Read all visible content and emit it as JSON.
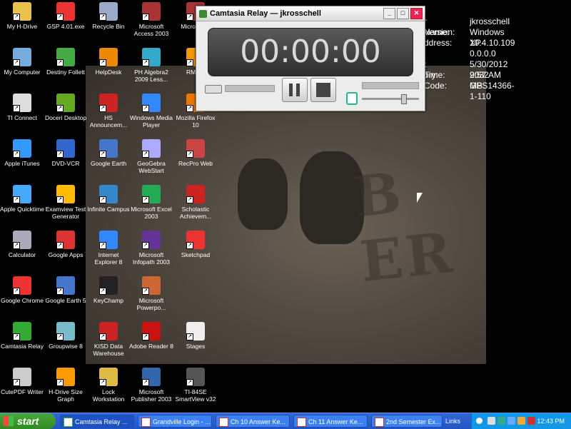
{
  "desktop": {
    "icons": [
      {
        "id": "my-h-drive",
        "label": "My H-Drive",
        "color": "#e8c24a"
      },
      {
        "id": "gsp",
        "label": "GSP 4.01.exe",
        "color": "#e33"
      },
      {
        "id": "recycle-bin",
        "label": "Recycle Bin",
        "color": "#9ac"
      },
      {
        "id": "ms-access",
        "label": "Microsoft Access 2003",
        "color": "#a33"
      },
      {
        "id": "ms-20",
        "label": "Microso 20",
        "color": "#a33"
      },
      {
        "id": "my-computer",
        "label": "My Computer",
        "color": "#7ad"
      },
      {
        "id": "destiny",
        "label": "Destiny Follett",
        "color": "#4a4"
      },
      {
        "id": "helpdesk",
        "label": "HelpDesk",
        "color": "#e80"
      },
      {
        "id": "ph-algebra",
        "label": "PH Algebra2 2009 Less...",
        "color": "#3ac"
      },
      {
        "id": "rm-ea",
        "label": "RM Ea",
        "color": "#e90"
      },
      {
        "id": "ti-connect",
        "label": "TI Connect",
        "color": "#ddd"
      },
      {
        "id": "doceri",
        "label": "Doceri Desktop",
        "color": "#6a2"
      },
      {
        "id": "hs-announce",
        "label": "HS Announcem...",
        "color": "#c22"
      },
      {
        "id": "wmp",
        "label": "Windows Media Player",
        "color": "#38f"
      },
      {
        "id": "firefox",
        "label": "Mozilla Firefox 10",
        "color": "#e70"
      },
      {
        "id": "itunes",
        "label": "Apple iTunes",
        "color": "#39f"
      },
      {
        "id": "dvd-vcr",
        "label": "DVD-VCR",
        "color": "#36c"
      },
      {
        "id": "google-earth",
        "label": "Google Earth",
        "color": "#47c"
      },
      {
        "id": "geogebra",
        "label": "GeoGebra WebStart",
        "color": "#aaf"
      },
      {
        "id": "recpro",
        "label": "RecPro Web",
        "color": "#c44"
      },
      {
        "id": "quicktime",
        "label": "Apple Quicktime",
        "color": "#4af"
      },
      {
        "id": "examview",
        "label": "Examview Test Generator",
        "color": "#fb0"
      },
      {
        "id": "infinite-campus",
        "label": "Infinite Campus",
        "color": "#38c"
      },
      {
        "id": "ms-excel",
        "label": "Microsoft Excel 2003",
        "color": "#2a5"
      },
      {
        "id": "scholastic",
        "label": "Scholastic Achievem...",
        "color": "#c22"
      },
      {
        "id": "calculator",
        "label": "Calculator",
        "color": "#aab"
      },
      {
        "id": "google-apps",
        "label": "Google Apps",
        "color": "#d33"
      },
      {
        "id": "ie8",
        "label": "Internet Explorer 8",
        "color": "#38f"
      },
      {
        "id": "ms-infopath",
        "label": "Microsoft Infopath 2003",
        "color": "#639"
      },
      {
        "id": "sketchpad",
        "label": "Sketchpad",
        "color": "#e33"
      },
      {
        "id": "chrome",
        "label": "Google Chrome",
        "color": "#e33"
      },
      {
        "id": "google-earth-5",
        "label": "Google Earth 5",
        "color": "#47c"
      },
      {
        "id": "keychamp",
        "label": "KeyChamp",
        "color": "#222"
      },
      {
        "id": "ms-powerpoint",
        "label": "Microsoft Powerpo...",
        "color": "#c63"
      },
      {
        "id": "camtasia-relay",
        "label": "Camtasia Relay",
        "color": "#3a3"
      },
      {
        "id": "groupwise",
        "label": "Groupwise 8",
        "color": "#7bc"
      },
      {
        "id": "kisd",
        "label": "KISD Data Warehouse",
        "color": "#c22"
      },
      {
        "id": "adobe-reader",
        "label": "Adobe Reader 8",
        "color": "#c11"
      },
      {
        "id": "stages",
        "label": "Stages",
        "color": "#eee"
      },
      {
        "id": "cutepdf",
        "label": "CutePDF Writer",
        "color": "#ccc"
      },
      {
        "id": "h-drive-size",
        "label": "H-Drive Size Graph",
        "color": "#f90"
      },
      {
        "id": "lock-workstation",
        "label": "Lock Workstation",
        "color": "#db4"
      },
      {
        "id": "ms-publisher",
        "label": "Microsoft Publisher 2003",
        "color": "#36a"
      },
      {
        "id": "ti84",
        "label": "TI-84SE SmartView v32",
        "color": "#555"
      }
    ],
    "sysinfo": [
      {
        "label": "r Name:",
        "value": "jkrosschell"
      },
      {
        "label": "Version:",
        "value": "Windows XP"
      },
      {
        "label": "ddress:",
        "value": "10.4.10.109"
      },
      {
        "label": "",
        "value": "0.0.0.0"
      },
      {
        "label": "t Time:",
        "value": "5/30/2012 9:57 AM"
      },
      {
        "label": "ory:",
        "value": "2032 MB"
      },
      {
        "label": "Code:",
        "value": "GPS14366-1-110"
      }
    ]
  },
  "camtasia": {
    "title": "Camtasia Relay — jkrosschell",
    "timer": "00:00:00",
    "controls": {
      "minimize": "_",
      "maximize": "□",
      "close": "✕"
    },
    "mic_level": 0.72
  },
  "taskbar": {
    "start_label": "start",
    "tasks": [
      {
        "id": "camtasia",
        "label": "Camtasia Relay ..."
      },
      {
        "id": "grandville",
        "label": "Grandville Login - ..."
      },
      {
        "id": "ch10",
        "label": "Ch 10 Answer Ke..."
      },
      {
        "id": "ch11",
        "label": "Ch 11 Answer Ke..."
      },
      {
        "id": "exam",
        "label": "2nd Semester Ex..."
      }
    ],
    "links_label": "Links",
    "clock": "12:43 PM"
  },
  "wallpaper_text": "B ER"
}
